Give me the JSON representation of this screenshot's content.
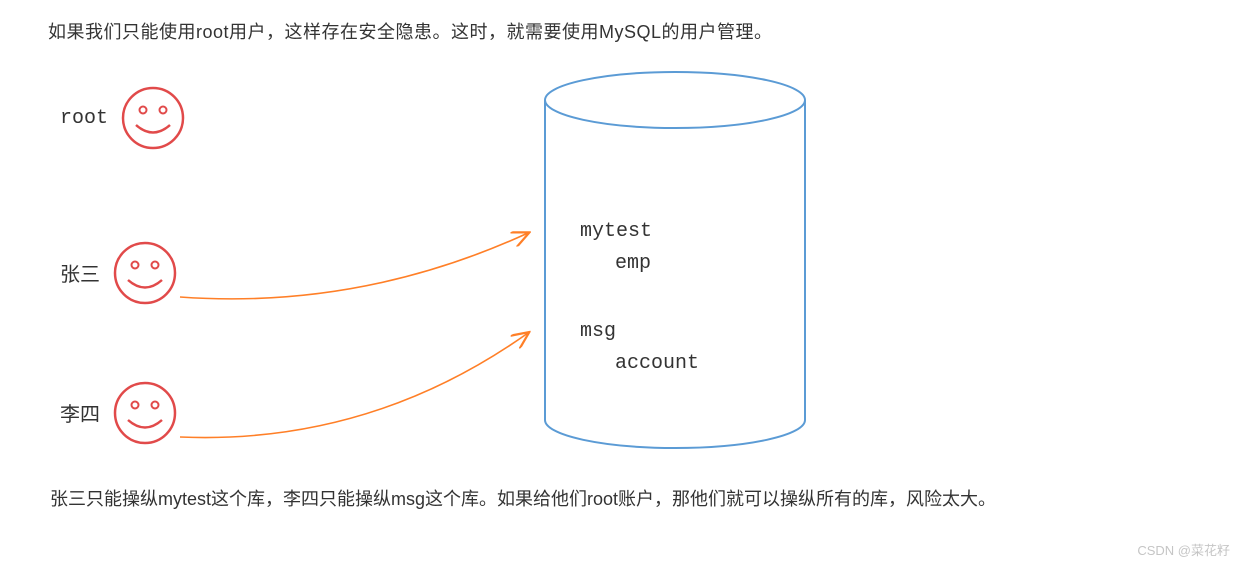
{
  "intro": "如果我们只能使用root用户，这样存在安全隐患。这时，就需要使用MySQL的用户管理。",
  "users": [
    {
      "label": "root"
    },
    {
      "label": "张三"
    },
    {
      "label": "李四"
    }
  ],
  "db": {
    "items": [
      {
        "name": "mytest",
        "sub": "emp"
      },
      {
        "name": "msg",
        "sub": "account"
      }
    ]
  },
  "footer": "张三只能操纵mytest这个库，李四只能操纵msg这个库。如果给他们root账户，那他们就可以操纵所有的库，风险太大。",
  "watermark": "CSDN @菜花籽",
  "colors": {
    "smiley": "#e14a4a",
    "arrow": "#ff7f27",
    "cylinder": "#5b9bd5"
  }
}
